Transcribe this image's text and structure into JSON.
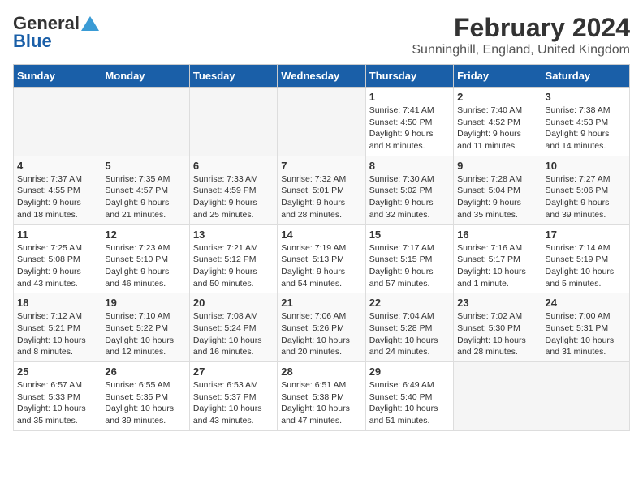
{
  "header": {
    "logo_line1": "General",
    "logo_line2": "Blue",
    "title": "February 2024",
    "subtitle": "Sunninghill, England, United Kingdom"
  },
  "weekdays": [
    "Sunday",
    "Monday",
    "Tuesday",
    "Wednesday",
    "Thursday",
    "Friday",
    "Saturday"
  ],
  "weeks": [
    [
      {
        "day": "",
        "info": ""
      },
      {
        "day": "",
        "info": ""
      },
      {
        "day": "",
        "info": ""
      },
      {
        "day": "",
        "info": ""
      },
      {
        "day": "1",
        "info": "Sunrise: 7:41 AM\nSunset: 4:50 PM\nDaylight: 9 hours\nand 8 minutes."
      },
      {
        "day": "2",
        "info": "Sunrise: 7:40 AM\nSunset: 4:52 PM\nDaylight: 9 hours\nand 11 minutes."
      },
      {
        "day": "3",
        "info": "Sunrise: 7:38 AM\nSunset: 4:53 PM\nDaylight: 9 hours\nand 14 minutes."
      }
    ],
    [
      {
        "day": "4",
        "info": "Sunrise: 7:37 AM\nSunset: 4:55 PM\nDaylight: 9 hours\nand 18 minutes."
      },
      {
        "day": "5",
        "info": "Sunrise: 7:35 AM\nSunset: 4:57 PM\nDaylight: 9 hours\nand 21 minutes."
      },
      {
        "day": "6",
        "info": "Sunrise: 7:33 AM\nSunset: 4:59 PM\nDaylight: 9 hours\nand 25 minutes."
      },
      {
        "day": "7",
        "info": "Sunrise: 7:32 AM\nSunset: 5:01 PM\nDaylight: 9 hours\nand 28 minutes."
      },
      {
        "day": "8",
        "info": "Sunrise: 7:30 AM\nSunset: 5:02 PM\nDaylight: 9 hours\nand 32 minutes."
      },
      {
        "day": "9",
        "info": "Sunrise: 7:28 AM\nSunset: 5:04 PM\nDaylight: 9 hours\nand 35 minutes."
      },
      {
        "day": "10",
        "info": "Sunrise: 7:27 AM\nSunset: 5:06 PM\nDaylight: 9 hours\nand 39 minutes."
      }
    ],
    [
      {
        "day": "11",
        "info": "Sunrise: 7:25 AM\nSunset: 5:08 PM\nDaylight: 9 hours\nand 43 minutes."
      },
      {
        "day": "12",
        "info": "Sunrise: 7:23 AM\nSunset: 5:10 PM\nDaylight: 9 hours\nand 46 minutes."
      },
      {
        "day": "13",
        "info": "Sunrise: 7:21 AM\nSunset: 5:12 PM\nDaylight: 9 hours\nand 50 minutes."
      },
      {
        "day": "14",
        "info": "Sunrise: 7:19 AM\nSunset: 5:13 PM\nDaylight: 9 hours\nand 54 minutes."
      },
      {
        "day": "15",
        "info": "Sunrise: 7:17 AM\nSunset: 5:15 PM\nDaylight: 9 hours\nand 57 minutes."
      },
      {
        "day": "16",
        "info": "Sunrise: 7:16 AM\nSunset: 5:17 PM\nDaylight: 10 hours\nand 1 minute."
      },
      {
        "day": "17",
        "info": "Sunrise: 7:14 AM\nSunset: 5:19 PM\nDaylight: 10 hours\nand 5 minutes."
      }
    ],
    [
      {
        "day": "18",
        "info": "Sunrise: 7:12 AM\nSunset: 5:21 PM\nDaylight: 10 hours\nand 8 minutes."
      },
      {
        "day": "19",
        "info": "Sunrise: 7:10 AM\nSunset: 5:22 PM\nDaylight: 10 hours\nand 12 minutes."
      },
      {
        "day": "20",
        "info": "Sunrise: 7:08 AM\nSunset: 5:24 PM\nDaylight: 10 hours\nand 16 minutes."
      },
      {
        "day": "21",
        "info": "Sunrise: 7:06 AM\nSunset: 5:26 PM\nDaylight: 10 hours\nand 20 minutes."
      },
      {
        "day": "22",
        "info": "Sunrise: 7:04 AM\nSunset: 5:28 PM\nDaylight: 10 hours\nand 24 minutes."
      },
      {
        "day": "23",
        "info": "Sunrise: 7:02 AM\nSunset: 5:30 PM\nDaylight: 10 hours\nand 28 minutes."
      },
      {
        "day": "24",
        "info": "Sunrise: 7:00 AM\nSunset: 5:31 PM\nDaylight: 10 hours\nand 31 minutes."
      }
    ],
    [
      {
        "day": "25",
        "info": "Sunrise: 6:57 AM\nSunset: 5:33 PM\nDaylight: 10 hours\nand 35 minutes."
      },
      {
        "day": "26",
        "info": "Sunrise: 6:55 AM\nSunset: 5:35 PM\nDaylight: 10 hours\nand 39 minutes."
      },
      {
        "day": "27",
        "info": "Sunrise: 6:53 AM\nSunset: 5:37 PM\nDaylight: 10 hours\nand 43 minutes."
      },
      {
        "day": "28",
        "info": "Sunrise: 6:51 AM\nSunset: 5:38 PM\nDaylight: 10 hours\nand 47 minutes."
      },
      {
        "day": "29",
        "info": "Sunrise: 6:49 AM\nSunset: 5:40 PM\nDaylight: 10 hours\nand 51 minutes."
      },
      {
        "day": "",
        "info": ""
      },
      {
        "day": "",
        "info": ""
      }
    ]
  ]
}
